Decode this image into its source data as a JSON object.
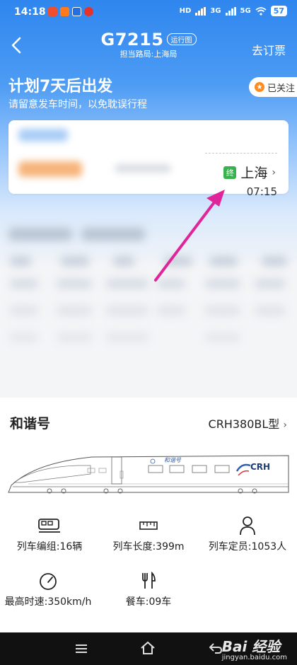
{
  "status_bar": {
    "time": "14:18",
    "network_left": "HD",
    "network_mid": "3G",
    "network_right": "5G",
    "battery": "57"
  },
  "header": {
    "train_number": "G7215",
    "route_button": "运行图",
    "bureau": "担当路局:上海局",
    "unbook": "去订票"
  },
  "plan": {
    "title": "计划7天后出发",
    "subtitle": "请留意发车时间，以免耽误行程",
    "follow_label": "已关注"
  },
  "terminal": {
    "badge": "终",
    "station": "上海",
    "time": "07:15"
  },
  "train_info": {
    "name": "和谐号",
    "model": "CRH380BL型",
    "specs": [
      {
        "label": "列车编组:16辆",
        "icon": "train-car-icon"
      },
      {
        "label": "列车长度:399m",
        "icon": "ruler-icon"
      },
      {
        "label": "列车定员:1053人",
        "icon": "person-icon"
      },
      {
        "label": "最高时速:350km/h",
        "icon": "speedometer-icon"
      },
      {
        "label": "餐车:09车",
        "icon": "fork-knife-icon"
      }
    ],
    "car_logo": "CRH",
    "car_emblem": "和谐号"
  },
  "watermark": {
    "brand": "Bai 经验",
    "url": "jingyan.baidu.com"
  },
  "colors": {
    "primary": "#2f86ee",
    "terminal_badge": "#37b24d",
    "arrow": "#e0249a",
    "follow_star": "#ff8a1e"
  }
}
